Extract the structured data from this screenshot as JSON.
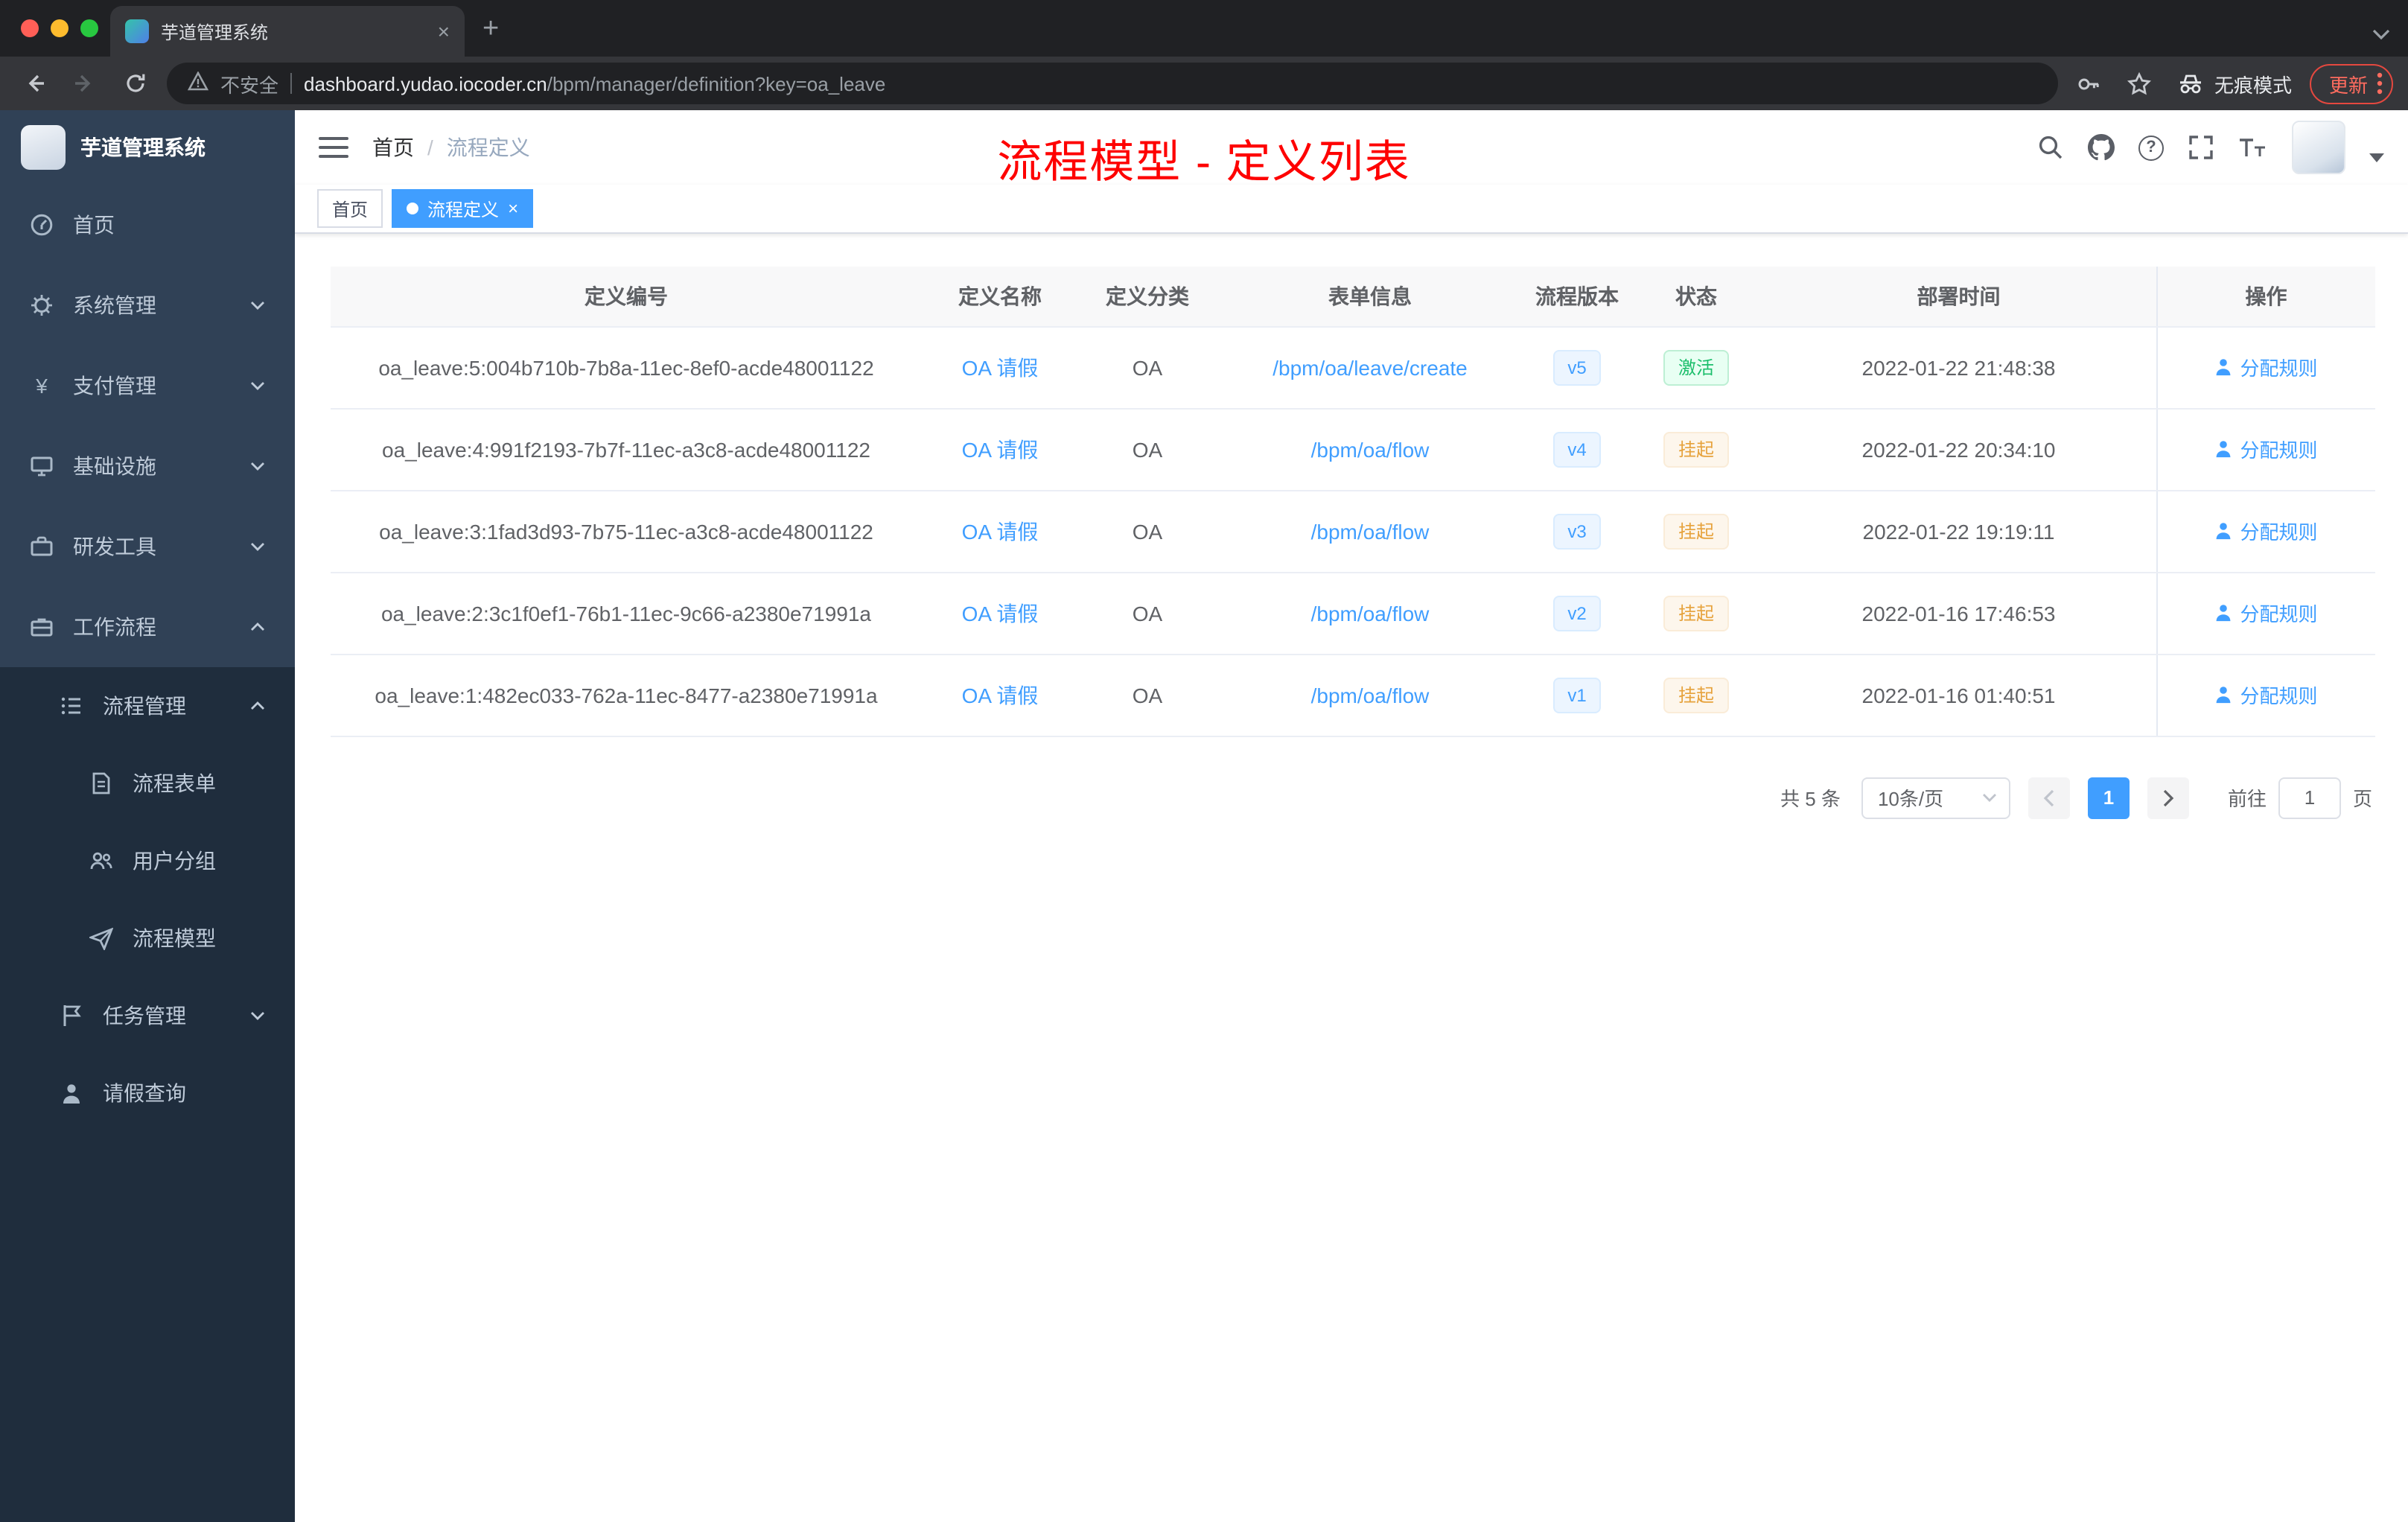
{
  "colors": {
    "primary": "#409eff",
    "success_status": "#1bbe6b",
    "warning_status": "#e6a23c",
    "annotation_red": "#ff0000",
    "sidebar_bg": "#304156",
    "submenu_bg": "#1f2d3d"
  },
  "icons": {
    "close": "×",
    "new_tab": "+",
    "question": "?",
    "yen": "¥"
  },
  "browser": {
    "tab_title": "芋道管理系统",
    "security_label": "不安全",
    "url_host": "dashboard.yudao.iocoder.cn",
    "url_path": "/bpm/manager/definition?key=oa_leave",
    "incognito_label": "无痕模式",
    "update_label": "更新"
  },
  "sidebar": {
    "logo_title": "芋道管理系统",
    "items": [
      {
        "label": "首页"
      },
      {
        "label": "系统管理",
        "expandable": true
      },
      {
        "label": "支付管理",
        "expandable": true
      },
      {
        "label": "基础设施",
        "expandable": true
      },
      {
        "label": "研发工具",
        "expandable": true
      },
      {
        "label": "工作流程",
        "expandable": true,
        "expanded": true,
        "children": [
          {
            "label": "流程管理",
            "expandable": true,
            "expanded": true,
            "children": [
              {
                "label": "流程表单"
              },
              {
                "label": "用户分组"
              },
              {
                "label": "流程模型"
              }
            ]
          },
          {
            "label": "任务管理",
            "expandable": true
          },
          {
            "label": "请假查询"
          }
        ]
      }
    ]
  },
  "header": {
    "breadcrumb_home": "首页",
    "breadcrumb_separator": "/",
    "breadcrumb_current": "流程定义",
    "annotation": "流程模型 - 定义列表"
  },
  "tags": {
    "home": "首页",
    "active": "流程定义"
  },
  "table": {
    "columns": [
      "定义编号",
      "定义名称",
      "定义分类",
      "表单信息",
      "流程版本",
      "状态",
      "部署时间",
      "操作"
    ],
    "rows": [
      {
        "id": "oa_leave:5:004b710b-7b8a-11ec-8ef0-acde48001122",
        "name": "OA 请假",
        "category": "OA",
        "form": "/bpm/oa/leave/create",
        "version": "v5",
        "status": "激活",
        "time": "2022-01-22 21:48:38",
        "action": "分配规则"
      },
      {
        "id": "oa_leave:4:991f2193-7b7f-11ec-a3c8-acde48001122",
        "name": "OA 请假",
        "category": "OA",
        "form": "/bpm/oa/flow",
        "version": "v4",
        "status": "挂起",
        "time": "2022-01-22 20:34:10",
        "action": "分配规则"
      },
      {
        "id": "oa_leave:3:1fad3d93-7b75-11ec-a3c8-acde48001122",
        "name": "OA 请假",
        "category": "OA",
        "form": "/bpm/oa/flow",
        "version": "v3",
        "status": "挂起",
        "time": "2022-01-22 19:19:11",
        "action": "分配规则"
      },
      {
        "id": "oa_leave:2:3c1f0ef1-76b1-11ec-9c66-a2380e71991a",
        "name": "OA 请假",
        "category": "OA",
        "form": "/bpm/oa/flow",
        "version": "v2",
        "status": "挂起",
        "time": "2022-01-16 17:46:53",
        "action": "分配规则"
      },
      {
        "id": "oa_leave:1:482ec033-762a-11ec-8477-a2380e71991a",
        "name": "OA 请假",
        "category": "OA",
        "form": "/bpm/oa/flow",
        "version": "v1",
        "status": "挂起",
        "time": "2022-01-16 01:40:51",
        "action": "分配规则"
      }
    ]
  },
  "pagination": {
    "total": "共 5 条",
    "page_size": "10条/页",
    "current": "1",
    "goto_label": "前往",
    "goto_value": "1",
    "page_unit": "页"
  }
}
